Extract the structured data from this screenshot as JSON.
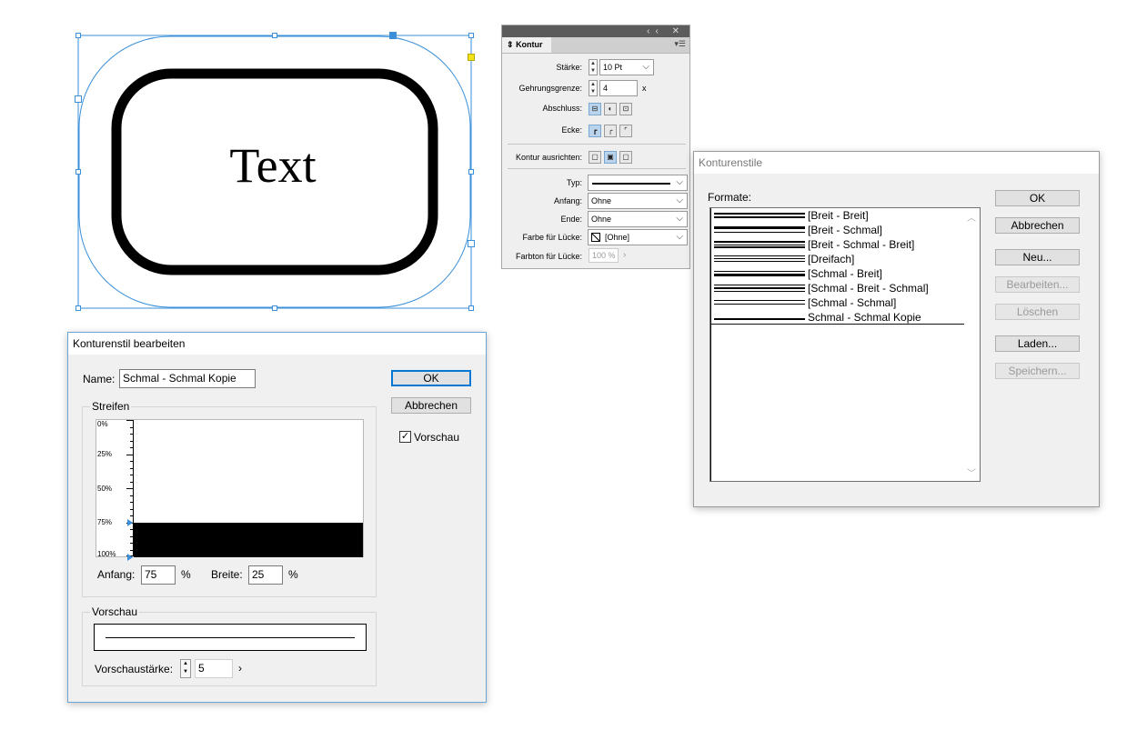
{
  "canvas": {
    "text": "Text",
    "accent_color": "#3a8fd8"
  },
  "kontur_panel": {
    "title_buttons": "‹‹ ✕",
    "tab_label": "Kontur",
    "tab_icon": "collapse-toggle-icon",
    "menu_icon": "panel-menu-icon",
    "staerke_label": "Stärke:",
    "staerke_value": "10 Pt",
    "gehrung_label": "Gehrungsgrenze:",
    "gehrung_value": "4",
    "gehrung_unit": "x",
    "abschluss_label": "Abschluss:",
    "ecke_label": "Ecke:",
    "ausrichten_label": "Kontur ausrichten:",
    "typ_label": "Typ:",
    "anfang_label": "Anfang:",
    "anfang_value": "Ohne",
    "ende_label": "Ende:",
    "ende_value": "Ohne",
    "farbe_label": "Farbe für Lücke:",
    "farbe_value": "[Ohne]",
    "farbton_label": "Farbton für Lücke:",
    "farbton_value": "100 %"
  },
  "konturenstile": {
    "title": "Konturenstile",
    "formate_label": "Formate:",
    "items": [
      {
        "label": "[Breit - Breit]"
      },
      {
        "label": "[Breit - Schmal]"
      },
      {
        "label": "[Breit - Schmal - Breit]"
      },
      {
        "label": "[Dreifach]"
      },
      {
        "label": "[Schmal - Breit]"
      },
      {
        "label": "[Schmal - Breit - Schmal]"
      },
      {
        "label": "[Schmal - Schmal]"
      },
      {
        "label": "Schmal - Schmal Kopie"
      }
    ],
    "buttons": {
      "ok": "OK",
      "abbrechen": "Abbrechen",
      "neu": "Neu...",
      "bearbeiten": "Bearbeiten...",
      "loeschen": "Löschen",
      "laden": "Laden...",
      "speichern": "Speichern..."
    }
  },
  "bearbeiten": {
    "title": "Konturenstil bearbeiten",
    "name_label": "Name:",
    "name_value": "Schmal - Schmal Kopie",
    "ok": "OK",
    "abbrechen": "Abbrechen",
    "vorschau_checkbox_label": "Vorschau",
    "vorschau_checked": true,
    "streifen_label": "Streifen",
    "ruler_labels": [
      "0%",
      "25%",
      "50%",
      "75%",
      "100%"
    ],
    "stripe": {
      "start_percent": 75,
      "width_percent": 25
    },
    "anfang_label": "Anfang:",
    "anfang_value": "75",
    "anfang_unit": "%",
    "breite_label": "Breite:",
    "breite_value": "25",
    "breite_unit": "%",
    "vorschau_group_label": "Vorschau",
    "vorschaustaerke_label": "Vorschaustärke:",
    "vorschaustaerke_value": "5"
  }
}
